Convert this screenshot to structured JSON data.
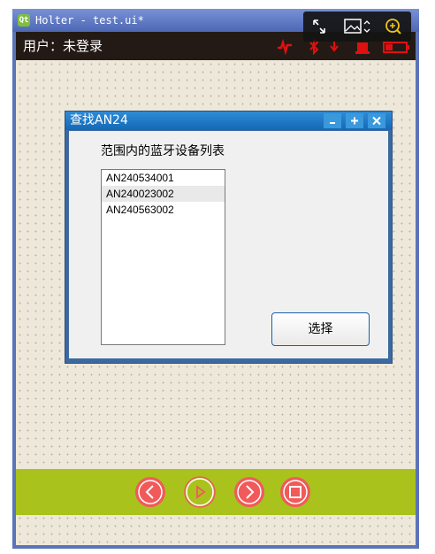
{
  "window": {
    "title": "Holter - test.ui*",
    "app_icon": "qt-creator-icon"
  },
  "userbar": {
    "label": "用户：未登录",
    "icons": [
      "heart-signal-icon",
      "bluetooth-icon",
      "battery-icon",
      "power-icon"
    ]
  },
  "viewer_toolbar": {
    "buttons": [
      "fullscreen-icon",
      "image-dropdown-icon",
      "zoom-in-icon"
    ]
  },
  "dialog": {
    "title": "查找AN24",
    "title_buttons": [
      "minimize-icon",
      "maximize-icon",
      "close-icon"
    ],
    "list_label": "范围内的蓝牙设备列表",
    "devices": [
      "AN240534001",
      "AN240023002",
      "AN240563002"
    ],
    "selected_index": 1,
    "select_button": "选择"
  },
  "bottombar": {
    "buttons": [
      "previous-icon",
      "play-icon",
      "next-icon",
      "stop-icon"
    ]
  },
  "colors": {
    "accent_red": "#f15a5a",
    "bottombar_green": "#a9c21c",
    "dialog_title_blue": "#1d78c4"
  }
}
